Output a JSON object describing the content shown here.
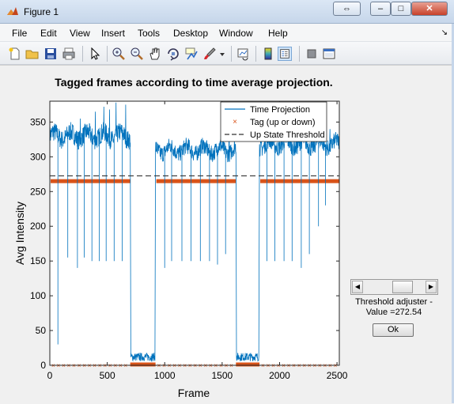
{
  "window": {
    "title": "Figure 1",
    "controls": {
      "restore": "⇔",
      "minimize": "–",
      "maximize": "□",
      "close": "✕"
    }
  },
  "menubar": {
    "items": [
      "File",
      "Edit",
      "View",
      "Insert",
      "Tools",
      "Desktop",
      "Window",
      "Help"
    ],
    "dock_arrow": "↘"
  },
  "toolbar": {
    "icons": [
      "new-figure-icon",
      "open-file-icon",
      "save-icon",
      "print-icon",
      "edit-plot-arrow-icon",
      "zoom-in-icon",
      "zoom-out-icon",
      "pan-hand-icon",
      "rotate-3d-icon",
      "data-cursor-icon",
      "brush-icon",
      "brush-dropdown-icon",
      "link-plot-icon",
      "insert-colorbar-icon",
      "insert-legend-icon",
      "hide-plot-tools-icon",
      "show-plot-tools-icon"
    ]
  },
  "controls": {
    "slider_value_fraction": 0.7,
    "threshold_label_line1": "Threshold adjuster -",
    "threshold_label_line2": "Value =272.54",
    "ok_label": "Ok"
  },
  "chart_data": {
    "type": "line",
    "title": "Tagged frames according to time average projection.",
    "xlabel": "Frame",
    "ylabel": "Avg Intensity",
    "xlim": [
      0,
      2520
    ],
    "ylim": [
      0,
      380
    ],
    "xticks": [
      0,
      500,
      1000,
      1500,
      2000,
      2500
    ],
    "yticks": [
      0,
      50,
      100,
      150,
      200,
      250,
      300,
      350
    ],
    "grid": false,
    "legend_position": "top-right",
    "colors": {
      "projection": "#0072bd",
      "tag": "#d95319",
      "threshold": "#333333"
    },
    "series": [
      {
        "name": "Time Projection",
        "style": "line",
        "segments": [
          {
            "x0": 0,
            "x1": 700,
            "base": 330,
            "noise": 14
          },
          {
            "x0": 705,
            "x1": 915,
            "base": 12,
            "noise": 6
          },
          {
            "x0": 920,
            "x1": 1620,
            "base": 310,
            "noise": 12
          },
          {
            "x0": 1625,
            "x1": 1820,
            "base": 12,
            "noise": 6
          },
          {
            "x0": 1825,
            "x1": 2520,
            "base": 318,
            "noise": 12
          }
        ],
        "dips": [
          {
            "x": 70,
            "y": 30
          },
          {
            "x": 155,
            "y": 155
          },
          {
            "x": 240,
            "y": 140
          },
          {
            "x": 300,
            "y": 155
          },
          {
            "x": 365,
            "y": 150
          },
          {
            "x": 430,
            "y": 150
          },
          {
            "x": 490,
            "y": 150
          },
          {
            "x": 560,
            "y": 150
          },
          {
            "x": 630,
            "y": 150
          },
          {
            "x": 1000,
            "y": 140
          },
          {
            "x": 1060,
            "y": 150
          },
          {
            "x": 1150,
            "y": 150
          },
          {
            "x": 1230,
            "y": 150
          },
          {
            "x": 1310,
            "y": 150
          },
          {
            "x": 1390,
            "y": 150
          },
          {
            "x": 1460,
            "y": 145
          },
          {
            "x": 1530,
            "y": 160
          },
          {
            "x": 1890,
            "y": 150
          },
          {
            "x": 1960,
            "y": 150
          },
          {
            "x": 2040,
            "y": 150
          },
          {
            "x": 2110,
            "y": 150
          },
          {
            "x": 2190,
            "y": 140
          },
          {
            "x": 2260,
            "y": 160
          },
          {
            "x": 2340,
            "y": 200
          },
          {
            "x": 2400,
            "y": 230
          }
        ],
        "spikes": [
          {
            "x": 35,
            "y": 345
          },
          {
            "x": 265,
            "y": 355
          },
          {
            "x": 395,
            "y": 365
          },
          {
            "x": 470,
            "y": 372
          },
          {
            "x": 520,
            "y": 368
          },
          {
            "x": 575,
            "y": 378
          },
          {
            "x": 660,
            "y": 375
          },
          {
            "x": 1490,
            "y": 342
          },
          {
            "x": 1560,
            "y": 355
          },
          {
            "x": 2300,
            "y": 353
          },
          {
            "x": 2360,
            "y": 345
          },
          {
            "x": 2440,
            "y": 340
          }
        ]
      },
      {
        "name": "Tag (up or down)",
        "style": "markers",
        "up_value": 265,
        "down_value": 0,
        "ranges_up": [
          [
            0,
            700
          ],
          [
            920,
            1620
          ],
          [
            1825,
            2520
          ]
        ],
        "ranges_down": [
          [
            700,
            920
          ],
          [
            1620,
            1825
          ]
        ]
      },
      {
        "name": "Up State Threshold",
        "style": "dashed",
        "value": 272.54
      }
    ]
  }
}
